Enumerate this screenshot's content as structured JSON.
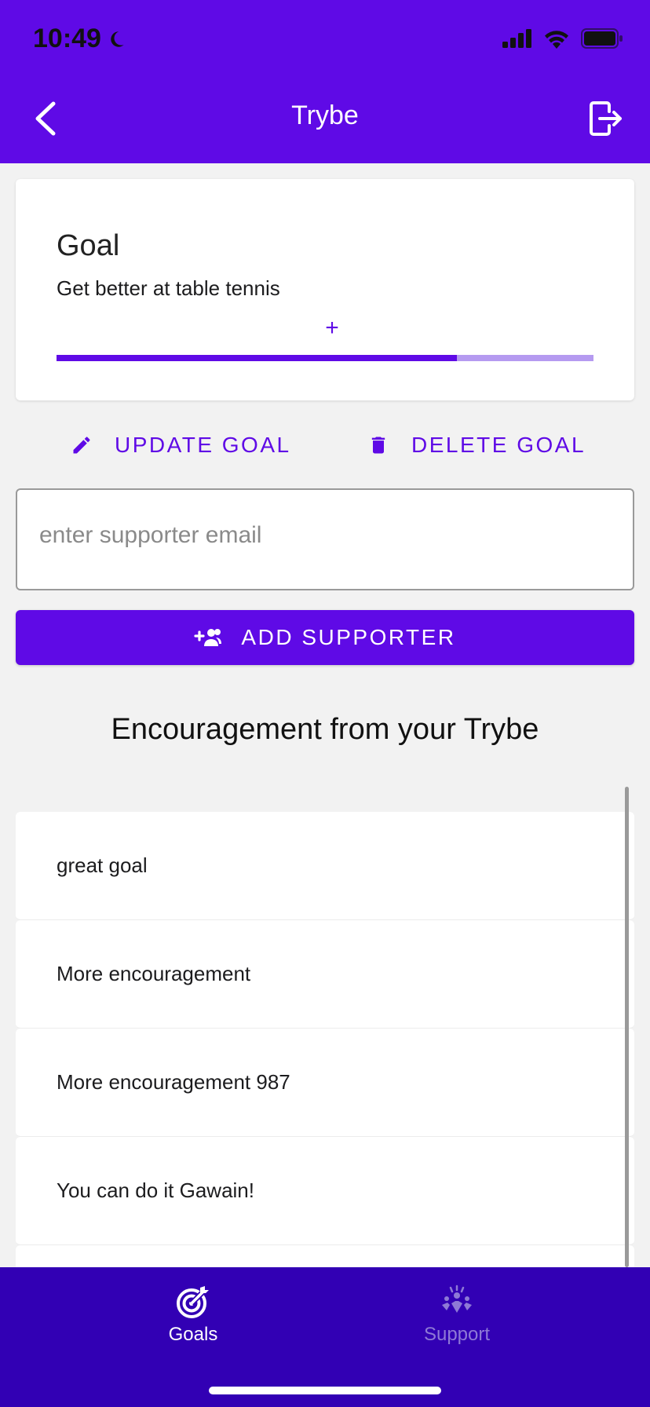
{
  "status_bar": {
    "time": "10:49"
  },
  "app_bar": {
    "title": "Trybe"
  },
  "goal_card": {
    "heading": "Goal",
    "description": "Get better at table tennis",
    "plus_label": "+",
    "progress_fraction": 0.745
  },
  "actions": {
    "update_label": "UPDATE GOAL",
    "delete_label": "DELETE GOAL"
  },
  "supporter_input": {
    "placeholder": "enter supporter email",
    "value": ""
  },
  "add_supporter_label": "ADD SUPPORTER",
  "encouragement": {
    "title": "Encouragement from your Trybe",
    "items": [
      {
        "text": "great goal"
      },
      {
        "text": "More encouragement"
      },
      {
        "text": "More encouragement 987"
      },
      {
        "text": "You can do it Gawain!"
      },
      {
        "text": ""
      }
    ]
  },
  "bottom_nav": {
    "items": [
      {
        "label": "Goals",
        "icon": "target-icon",
        "active": true
      },
      {
        "label": "Support",
        "icon": "group-cheer-icon",
        "active": false
      }
    ]
  },
  "colors": {
    "primary": "#5f0ae6",
    "nav_background": "#3200b4",
    "progress_track": "#b59af0",
    "inactive_nav": "#8e79d6"
  }
}
